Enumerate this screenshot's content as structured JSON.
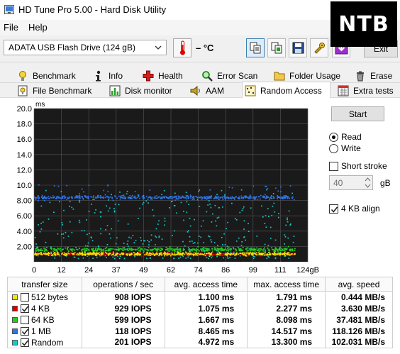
{
  "window": {
    "title": "HD Tune Pro 5.00 - Hard Disk Utility",
    "watermark": "NTB"
  },
  "menu": {
    "file": "File",
    "help": "Help"
  },
  "toolbar": {
    "drive": "ADATA   USB Flash Drive  (124 gB)",
    "temperature": "– °C",
    "exit_label": "Exit",
    "icons": [
      "thermometer-icon",
      "copy-text-icon",
      "copy-screenshot-icon",
      "save-icon",
      "options-icon",
      "download-icon"
    ]
  },
  "tabs": {
    "row1": [
      {
        "label": "Benchmark",
        "icon": "benchmark-icon"
      },
      {
        "label": "Info",
        "icon": "info-icon"
      },
      {
        "label": "Health",
        "icon": "health-icon"
      },
      {
        "label": "Error Scan",
        "icon": "error-scan-icon"
      },
      {
        "label": "Folder Usage",
        "icon": "folder-icon"
      },
      {
        "label": "Erase",
        "icon": "erase-icon"
      }
    ],
    "row2": [
      {
        "label": "File Benchmark",
        "icon": "file-benchmark-icon"
      },
      {
        "label": "Disk monitor",
        "icon": "disk-monitor-icon"
      },
      {
        "label": "AAM",
        "icon": "speaker-icon"
      },
      {
        "label": "Random Access",
        "icon": "random-access-icon",
        "active": true
      },
      {
        "label": "Extra tests",
        "icon": "extra-tests-icon"
      }
    ]
  },
  "controls": {
    "start_label": "Start",
    "read_label": "Read",
    "write_label": "Write",
    "mode_selected": "Read",
    "short_stroke_label": "Short stroke",
    "short_stroke_checked": false,
    "short_stroke_value": "40",
    "short_stroke_unit": "gB",
    "align_label": "4 KB align",
    "align_checked": true
  },
  "chart_data": {
    "type": "scatter",
    "y_unit_label": "ms",
    "x_unit_label": "gB",
    "ylim": [
      0,
      20
    ],
    "xlim": [
      0,
      124
    ],
    "y_ticks": [
      "20.0",
      "18.0",
      "16.0",
      "14.0",
      "12.0",
      "10.0",
      "8.00",
      "6.00",
      "4.00",
      "2.00"
    ],
    "x_ticks": [
      "0",
      "12",
      "24",
      "37",
      "49",
      "62",
      "74",
      "86",
      "99",
      "111",
      "124gB"
    ],
    "grid": true,
    "background": "#1a1a1a",
    "series": [
      {
        "name": "512 bytes",
        "color": "#f5e600",
        "y_mean": 1.1,
        "y_spread": 0.35,
        "x_to": 118
      },
      {
        "name": "4 KB",
        "color": "#d40000",
        "y_mean": 1.08,
        "y_spread": 0.3,
        "x_to": 118
      },
      {
        "name": "64 KB",
        "color": "#22cc22",
        "y_mean": 1.67,
        "y_spread": 0.45,
        "x_to": 118
      },
      {
        "name": "1 MB",
        "color": "#2f74e8",
        "y_mean": 8.47,
        "y_spread": 0.4,
        "x_to": 118
      },
      {
        "name": "Random",
        "color": "#18c8c8",
        "y_mean": 4.97,
        "y_spread": 4.5,
        "x_to": 118
      }
    ]
  },
  "results": {
    "headers": [
      "transfer size",
      "operations / sec",
      "avg. access time",
      "max. access time",
      "avg. speed"
    ],
    "rows": [
      {
        "label": "512 bytes",
        "color": "#f5e600",
        "checked": false,
        "ops": "908 IOPS",
        "avg": "1.100 ms",
        "max": "1.791 ms",
        "speed": "0.444 MB/s"
      },
      {
        "label": "4 KB",
        "color": "#d40000",
        "checked": true,
        "ops": "929 IOPS",
        "avg": "1.075 ms",
        "max": "2.277 ms",
        "speed": "3.630 MB/s"
      },
      {
        "label": "64 KB",
        "color": "#22cc22",
        "checked": false,
        "ops": "599 IOPS",
        "avg": "1.667 ms",
        "max": "8.098 ms",
        "speed": "37.481 MB/s"
      },
      {
        "label": "1 MB",
        "color": "#2f74e8",
        "checked": true,
        "ops": "118 IOPS",
        "avg": "8.465 ms",
        "max": "14.517 ms",
        "speed": "118.126 MB/s"
      },
      {
        "label": "Random",
        "color": "#18c8c8",
        "checked": true,
        "ops": "201 IOPS",
        "avg": "4.972 ms",
        "max": "13.300 ms",
        "speed": "102.031 MB/s"
      }
    ]
  }
}
